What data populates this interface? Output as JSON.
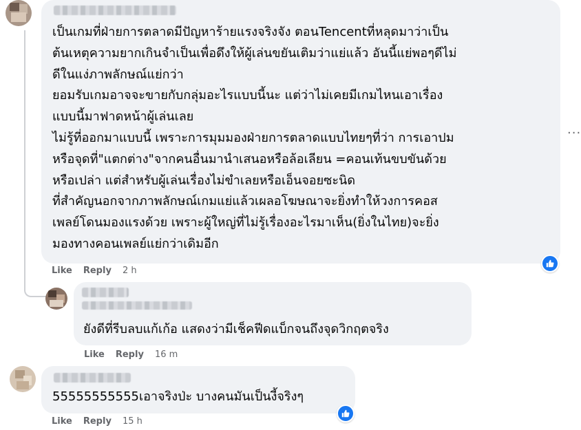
{
  "comments": [
    {
      "text": "เป็นเกมที่ฝ่ายการตลาดมีปัญหาร้ายแรงจริงจัง ตอนTencentที่หลุดมาว่าเป็น\nต้นเหตุความยากเกินจำเป็นเพื่อดึงให้ผู้เล่นขยันเติมว่าแย่แล้ว อันนี้แย่พอๆดีไม่\nดีในแง่ภาพลักษณ์แย่กว่า\nยอมรับเกมอาจจะขายกับกลุ่มอะไรแบบนี้นะ แต่ว่าไม่เคยมีเกมไหนเอาเรื่อง\nแบบนี้มาฟาดหน้าผู้เล่นเลย\nไม่รู้ที่ออกมาแบบนี้ เพราะการมุมมองฝ่ายการตลาดแบบไทยๆที่ว่า การเอาปม\nหรือจุดที่\"แตกต่าง\"จากคนอื่นมานำเสนอหรือล้อเลียน =คอนเท้นขบขันด้วย\nหรือเปล่า แต่สำหรับผู้เล่นเรื่องไม่ขำเลยหรือเอ็นจอยซะนิด\nที่สำคัญนอกจากภาพลักษณ์เกมแย่แล้วเผลอโฆษณาจะยิ่งทำให้วงการคอส\nเพลย์โดนมองแรงด้วย เพราะผู้ใหญ่ที่ไม่รู้เรื่องอะไรมาเห็น(ยิ่งในไทย)จะยิ่ง\nมองทางคอนเพลย์แย่กว่าเดิมอีก",
      "like_label": "Like",
      "reply_label": "Reply",
      "time": "2 h"
    },
    {
      "text": "ยังดีที่รีบลบแก้เก้อ แสดงว่ามีเช็คฟีดแบ็กจนถึงจุดวิกฤตจริง",
      "like_label": "Like",
      "reply_label": "Reply",
      "time": "16 m"
    },
    {
      "text": "55555555555เอาจริงป่ะ บางคนมันเป็นงี้จริงๆ",
      "like_label": "Like",
      "reply_label": "Reply",
      "time": "15 h"
    }
  ],
  "more_options": "...",
  "colors": {
    "bubble": "#f0f2f5",
    "action_text": "#65676b",
    "like_blue": "#1877f2"
  },
  "icons": [
    "thumbs-up-icon",
    "more-options-icon"
  ]
}
